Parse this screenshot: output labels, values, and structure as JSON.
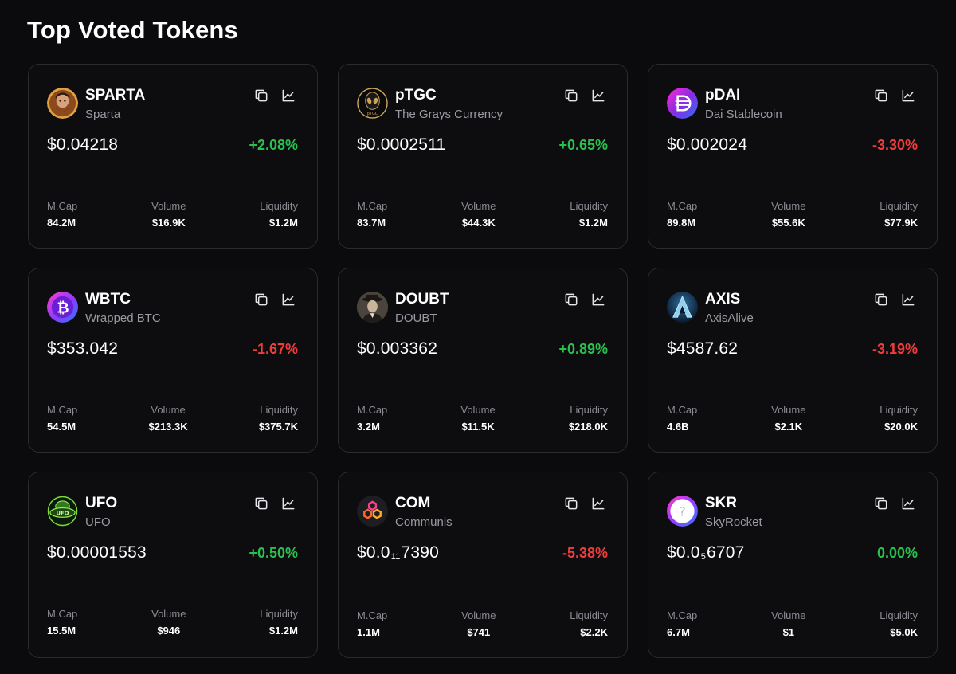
{
  "page": {
    "title": "Top Voted Tokens"
  },
  "labels": {
    "mcap": "M.Cap",
    "volume": "Volume",
    "liquidity": "Liquidity"
  },
  "colors": {
    "up": "#27c24c",
    "down": "#f23b3b",
    "card_bg": "#0d0d10",
    "border": "#2a2a2f"
  },
  "tokens": [
    {
      "symbol": "SPARTA",
      "name": "Sparta",
      "icon": "sparta-avatar",
      "price": "$0.04218",
      "change": "+2.08%",
      "direction": "up",
      "mcap": "84.2M",
      "volume": "$16.9K",
      "liquidity": "$1.2M"
    },
    {
      "symbol": "pTGC",
      "name": "The Grays Currency",
      "icon": "ptgc-alien-logo",
      "price": "$0.0002511",
      "change": "+0.65%",
      "direction": "up",
      "mcap": "83.7M",
      "volume": "$44.3K",
      "liquidity": "$1.2M"
    },
    {
      "symbol": "pDAI",
      "name": "Dai Stablecoin",
      "icon": "dai-logo",
      "price": "$0.002024",
      "change": "-3.30%",
      "direction": "down",
      "mcap": "89.8M",
      "volume": "$55.6K",
      "liquidity": "$77.9K"
    },
    {
      "symbol": "WBTC",
      "name": "Wrapped BTC",
      "icon": "wbtc-logo",
      "price": "$353.042",
      "change": "-1.67%",
      "direction": "down",
      "mcap": "54.5M",
      "volume": "$213.3K",
      "liquidity": "$375.7K"
    },
    {
      "symbol": "DOUBT",
      "name": "DOUBT",
      "icon": "doubt-avatar",
      "price": "$0.003362",
      "change": "+0.89%",
      "direction": "up",
      "mcap": "3.2M",
      "volume": "$11.5K",
      "liquidity": "$218.0K"
    },
    {
      "symbol": "AXIS",
      "name": "AxisAlive",
      "icon": "axis-logo",
      "price": "$4587.62",
      "change": "-3.19%",
      "direction": "down",
      "mcap": "4.6B",
      "volume": "$2.1K",
      "liquidity": "$20.0K"
    },
    {
      "symbol": "UFO",
      "name": "UFO",
      "icon": "ufo-logo",
      "price": "$0.00001553",
      "change": "+0.50%",
      "direction": "up",
      "mcap": "15.5M",
      "volume": "$946",
      "liquidity": "$1.2M"
    },
    {
      "symbol": "COM",
      "name": "Communis",
      "icon": "communis-logo",
      "price_main": "$0.0",
      "price_sub": "11",
      "price_rest": "7390",
      "change": "-5.38%",
      "direction": "down",
      "mcap": "1.1M",
      "volume": "$741",
      "liquidity": "$2.2K"
    },
    {
      "symbol": "SKR",
      "name": "SkyRocket",
      "icon": "unknown-token-logo",
      "price_main": "$0.0",
      "price_sub": "5",
      "price_rest": "6707",
      "change": "0.00%",
      "direction": "up",
      "mcap": "6.7M",
      "volume": "$1",
      "liquidity": "$5.0K"
    }
  ]
}
